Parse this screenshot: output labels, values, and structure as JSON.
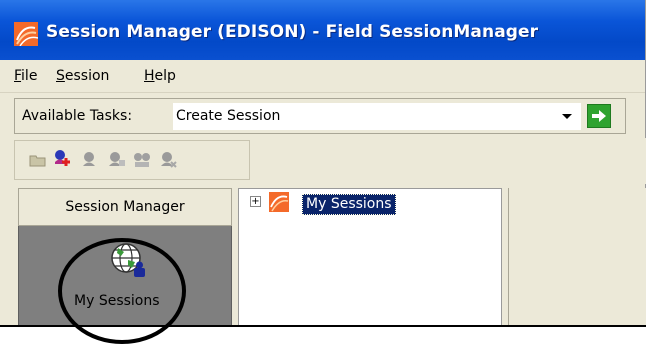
{
  "window": {
    "title": "Session Manager (EDISON) - Field SessionManager",
    "app_icon": "session-manager-icon"
  },
  "menu": {
    "items": [
      {
        "label_underlined": "F",
        "label_rest": "ile"
      },
      {
        "label_underlined": "S",
        "label_rest": "ession"
      },
      {
        "label_underlined": "H",
        "label_rest": "elp"
      }
    ]
  },
  "tasks": {
    "label": "Available Tasks:",
    "selected": "Create Session"
  },
  "toolbar": {
    "icons": [
      "open-folder-icon",
      "new-session-icon",
      "session-icon",
      "session-chat-icon",
      "session-group-icon",
      "session-remove-icon"
    ]
  },
  "left_panel": {
    "header": "Session Manager",
    "item_label": "My Sessions",
    "item_icon": "globe-user-icon"
  },
  "tree": {
    "expander": "+",
    "root_label": "My Sessions",
    "root_icon": "sessions-folder-icon"
  },
  "colors": {
    "titlebar": "#0a55d8",
    "selection": "#0a246a",
    "go_button": "#2fa32f"
  }
}
